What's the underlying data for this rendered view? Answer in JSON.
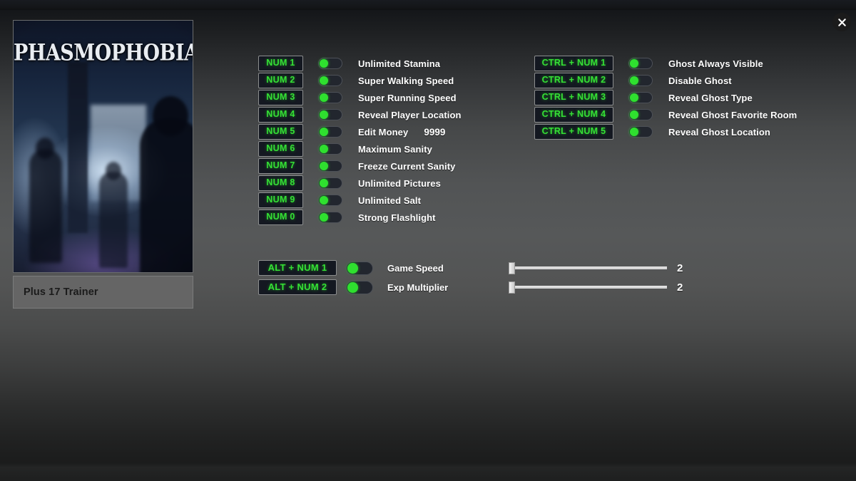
{
  "window": {
    "close_label": "×",
    "close_icon": "close-icon"
  },
  "game": {
    "title": "PHASMOPHOBIA",
    "caption": "Plus 17 Trainer"
  },
  "options_left": [
    {
      "hotkey": "NUM 1",
      "label": "Unlimited Stamina",
      "toggle": "on",
      "value": ""
    },
    {
      "hotkey": "NUM 2",
      "label": "Super Walking Speed",
      "toggle": "on",
      "value": ""
    },
    {
      "hotkey": "NUM 3",
      "label": "Super Running Speed",
      "toggle": "on",
      "value": ""
    },
    {
      "hotkey": "NUM 4",
      "label": "Reveal Player Location",
      "toggle": "on",
      "value": ""
    },
    {
      "hotkey": "NUM 5",
      "label": "Edit Money",
      "toggle": "on",
      "value": "9999"
    },
    {
      "hotkey": "NUM 6",
      "label": "Maximum Sanity",
      "toggle": "on",
      "value": ""
    },
    {
      "hotkey": "NUM 7",
      "label": "Freeze Current Sanity",
      "toggle": "on",
      "value": ""
    },
    {
      "hotkey": "NUM 8",
      "label": "Unlimited Pictures",
      "toggle": "on",
      "value": ""
    },
    {
      "hotkey": "NUM 9",
      "label": "Unlimited Salt",
      "toggle": "on",
      "value": ""
    },
    {
      "hotkey": "NUM 0",
      "label": "Strong Flashlight",
      "toggle": "on",
      "value": ""
    }
  ],
  "options_right": [
    {
      "hotkey": "CTRL + NUM 1",
      "label": "Ghost Always Visible",
      "toggle": "on"
    },
    {
      "hotkey": "CTRL + NUM 2",
      "label": "Disable Ghost",
      "toggle": "on"
    },
    {
      "hotkey": "CTRL + NUM 3",
      "label": "Reveal Ghost Type",
      "toggle": "on"
    },
    {
      "hotkey": "CTRL + NUM 4",
      "label": "Reveal Ghost Favorite Room",
      "toggle": "on"
    },
    {
      "hotkey": "CTRL + NUM 5",
      "label": "Reveal Ghost Location",
      "toggle": "on"
    }
  ],
  "sliders": [
    {
      "hotkey": "ALT + NUM 1",
      "label": "Game Speed",
      "toggle": "on",
      "value": "2",
      "percent": 0
    },
    {
      "hotkey": "ALT + NUM 2",
      "label": "Exp Multiplier",
      "toggle": "on",
      "value": "2",
      "percent": 0
    }
  ],
  "colors": {
    "hotkey_text": "#35e035",
    "hotkey_bg": "#141821",
    "toggle_knob": "#2fe02f",
    "label_text": "#ffffff",
    "caption_bg": "#656565",
    "caption_text": "#1b1b1b"
  }
}
